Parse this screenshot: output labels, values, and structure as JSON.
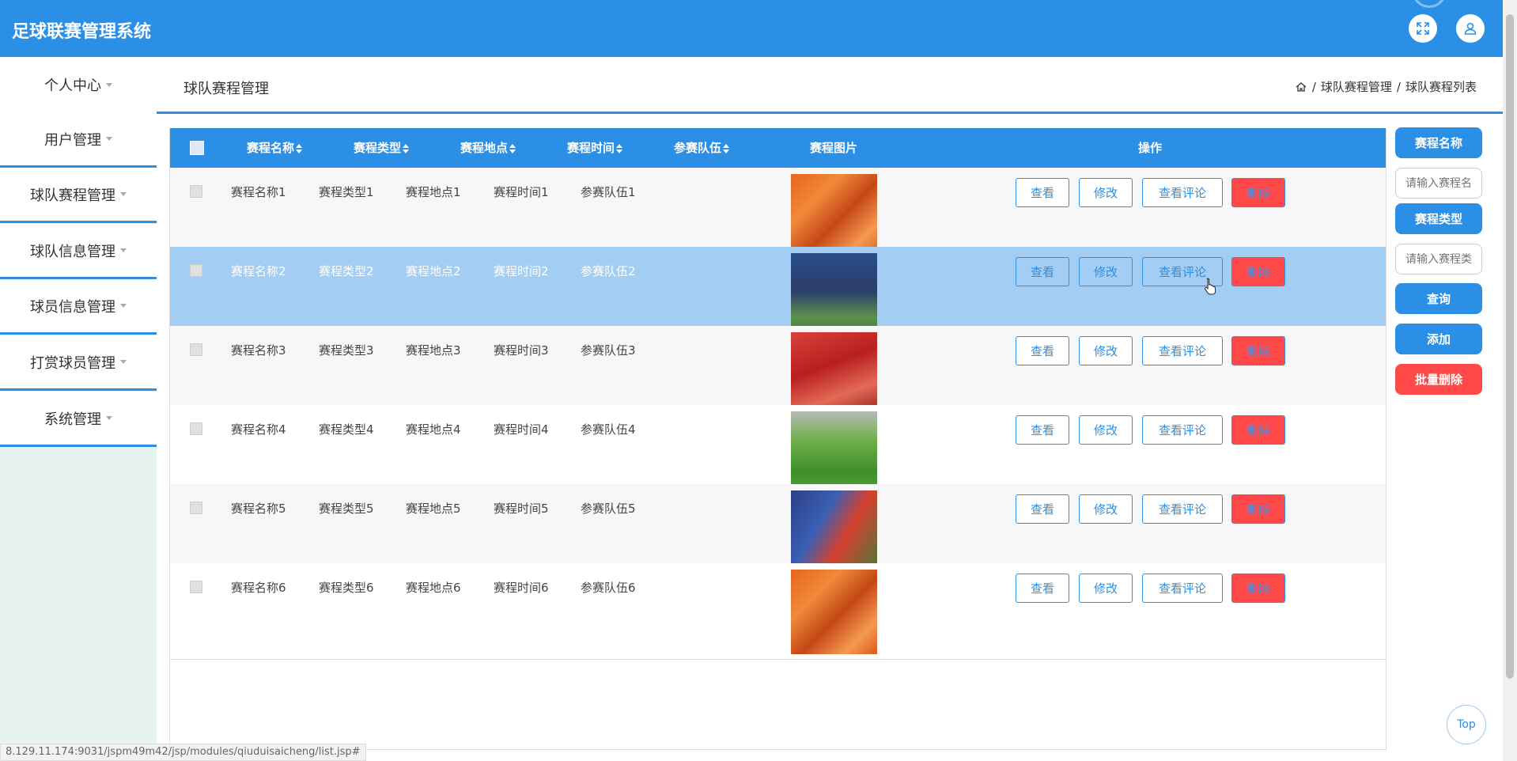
{
  "app": {
    "title": "足球联赛管理系统"
  },
  "header": {
    "fullscreen_icon": "expand-icon",
    "user_icon": "user-icon"
  },
  "sidebar": {
    "items": [
      {
        "label": "个人中心"
      },
      {
        "label": "用户管理"
      },
      {
        "label": "球队赛程管理"
      },
      {
        "label": "球队信息管理"
      },
      {
        "label": "球员信息管理"
      },
      {
        "label": "打赏球员管理"
      },
      {
        "label": "系统管理"
      }
    ]
  },
  "page": {
    "title": "球队赛程管理",
    "breadcrumb": [
      "球队赛程管理",
      "球队赛程列表"
    ],
    "separator": "/"
  },
  "table": {
    "headers": [
      "赛程名称",
      "赛程类型",
      "赛程地点",
      "赛程时间",
      "参赛队伍",
      "赛程图片",
      "操作"
    ],
    "rows": [
      {
        "name": "赛程名称1",
        "type": "赛程类型1",
        "place": "赛程地点1",
        "time": "赛程时间1",
        "team": "参赛队伍1",
        "image": "orange"
      },
      {
        "name": "赛程名称2",
        "type": "赛程类型2",
        "place": "赛程地点2",
        "time": "赛程时间2",
        "team": "参赛队伍2",
        "image": "navy"
      },
      {
        "name": "赛程名称3",
        "type": "赛程类型3",
        "place": "赛程地点3",
        "time": "赛程时间3",
        "team": "参赛队伍3",
        "image": "red"
      },
      {
        "name": "赛程名称4",
        "type": "赛程类型4",
        "place": "赛程地点4",
        "time": "赛程时间4",
        "team": "参赛队伍4",
        "image": "green"
      },
      {
        "name": "赛程名称5",
        "type": "赛程类型5",
        "place": "赛程地点5",
        "time": "赛程时间5",
        "team": "参赛队伍5",
        "image": "mix"
      },
      {
        "name": "赛程名称6",
        "type": "赛程类型6",
        "place": "赛程地点6",
        "time": "赛程时间6",
        "team": "参赛队伍6",
        "image": "orange"
      }
    ],
    "actions": {
      "view": "查看",
      "edit": "修改",
      "comments": "查看评论",
      "delete": "删除"
    }
  },
  "search": {
    "name_label": "赛程名称",
    "name_placeholder": "请输入赛程名称",
    "type_label": "赛程类型",
    "type_placeholder": "请输入赛程类型",
    "query": "查询",
    "add": "添加",
    "batch_delete": "批量删除"
  },
  "back_to_top": "Top",
  "status_url": "8.129.11.174:9031/jspm49m42/jsp/modules/qiuduisaicheng/list.jsp#",
  "colors": {
    "primary": "#2b8fe6",
    "danger": "#ff4848",
    "highlight_row": "#a3cdf2",
    "sidebar_bg": "#e6f3ee"
  }
}
